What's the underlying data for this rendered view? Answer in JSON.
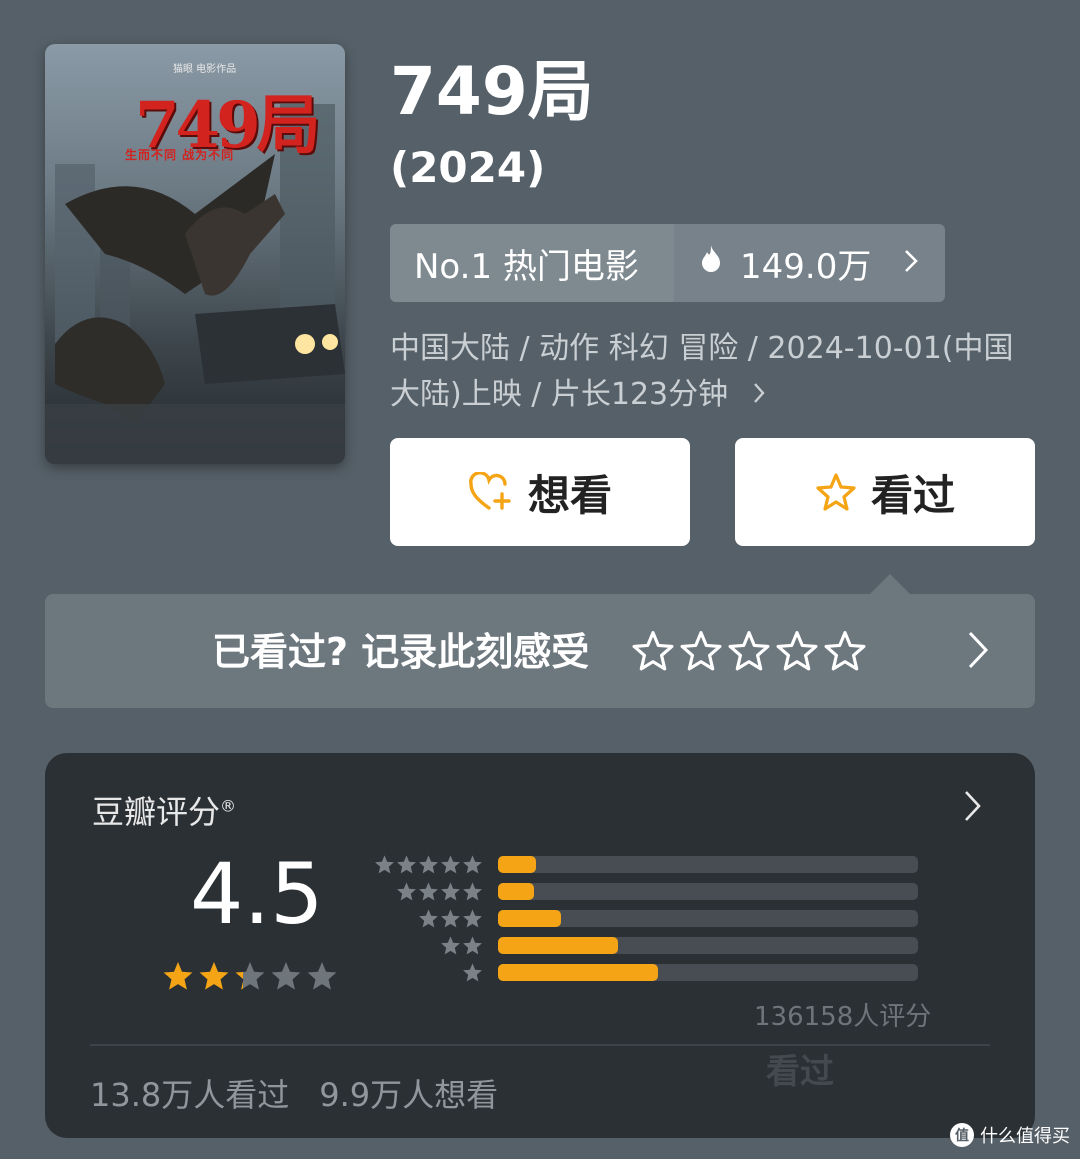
{
  "poster": {
    "studio": "猫眼 电影作品",
    "title": "749局",
    "tagline": "生而不同 战为不同"
  },
  "movie": {
    "title": "749局",
    "year": "(2024)"
  },
  "rank": {
    "label": "No.1 热门电影",
    "heat": "149.0万",
    "heat_icon": "fire-icon",
    "chevron": "›"
  },
  "meta": {
    "line1": "中国大陆 / 动作 科幻 冒险 / 2024-10-01(中国",
    "line2": "大陆)上映 / 片长123分钟",
    "chevron": "›"
  },
  "buttons": {
    "want": "想看",
    "want_icon": "heart-plus-icon",
    "seen": "看过",
    "seen_icon": "star-outline-icon"
  },
  "record": {
    "prompt": "已看过? 记录此刻感受",
    "stars_total": 5,
    "chevron": "›"
  },
  "rating": {
    "label": "豆瓣评分",
    "registered_mark": "®",
    "score": "4.5",
    "star_fill_fraction": 0.45,
    "distribution": [
      {
        "stars": 5,
        "fraction": 0.09
      },
      {
        "stars": 4,
        "fraction": 0.085
      },
      {
        "stars": 3,
        "fraction": 0.15
      },
      {
        "stars": 2,
        "fraction": 0.285
      },
      {
        "stars": 1,
        "fraction": 0.38
      }
    ],
    "count_text": "136158人评分",
    "seen_count": "13.8万人看过",
    "want_count": "9.9万人想看",
    "watermark": "看过"
  },
  "footer": {
    "brand": "什么值得买",
    "logo_glyph": "值"
  },
  "colors": {
    "background": "#566068",
    "accent_orange": "#f5a415",
    "card_dark": "#2b3034",
    "poster_red": "#d2231f"
  }
}
